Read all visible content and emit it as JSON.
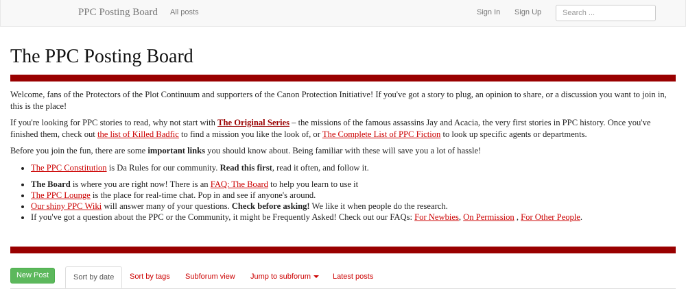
{
  "navbar": {
    "brand": "PPC Posting Board",
    "all_posts": "All posts",
    "sign_in": "Sign In",
    "sign_up": "Sign Up",
    "search_placeholder": "Search ..."
  },
  "page": {
    "title": "The PPC Posting Board",
    "p1": "Welcome, fans of the Protectors of the Plot Continuum and supporters of the Canon Protection Initiative! If you've got a story to plug, an opinion to share, or a discussion you want to join in, this is the place!",
    "p2": {
      "t1": "If you're looking for PPC stories to read, why not start with ",
      "link1": "The Original Series",
      "t2": " – the missions of the famous assassins Jay and Acacia, the very first stories in PPC history. Once you've finished them, check out ",
      "link2": "the list of Killed Badfic",
      "t3": " to find a mission you like the look of, or ",
      "link3": "The Complete List of PPC Fiction",
      "t4": " to look up specific agents or departments."
    },
    "p3": {
      "t1": "Before you join the fun, there are some ",
      "bold": "important links",
      "t2": " you should know about. Being familiar with these will save you a lot of hassle!"
    },
    "list1": {
      "link": "The PPC Constitution",
      "t1": " is Da Rules for our community. ",
      "bold": "Read this first",
      "t2": ", read it often, and follow it."
    },
    "list2": {
      "board_bold": "The Board",
      "board_t1": " is where you are right now! There is an ",
      "board_link": "FAQ: The Board",
      "board_t2": " to help you learn to use it",
      "lounge_link": "The PPC Lounge",
      "lounge_t": " is the place for real-time chat. Pop in and see if anyone's around.",
      "wiki_link": "Our shiny PPC Wiki",
      "wiki_t1": " will answer many of your questions. ",
      "wiki_bold": "Check before asking!",
      "wiki_t2": " We like it when people do the research.",
      "faq_t1": "If you've got a question about the PPC or the Community, it might be Frequently Asked! Check out our FAQs: ",
      "faq_link1": "For Newbies",
      "faq_sep1": ", ",
      "faq_link2": "On Permission",
      "faq_sep2": " , ",
      "faq_link3": "For Other People",
      "faq_end": "."
    }
  },
  "tabs": {
    "new_post": "New Post",
    "sort_by_date": "Sort by date",
    "sort_by_tags": "Sort by tags",
    "subforum_view": "Subforum view",
    "jump_to_subforum": "Jump to subforum",
    "latest_posts": "Latest posts"
  },
  "colors": {
    "rule": "#990000",
    "link": "#cc0000",
    "new_post_button": "#5cb85c"
  }
}
